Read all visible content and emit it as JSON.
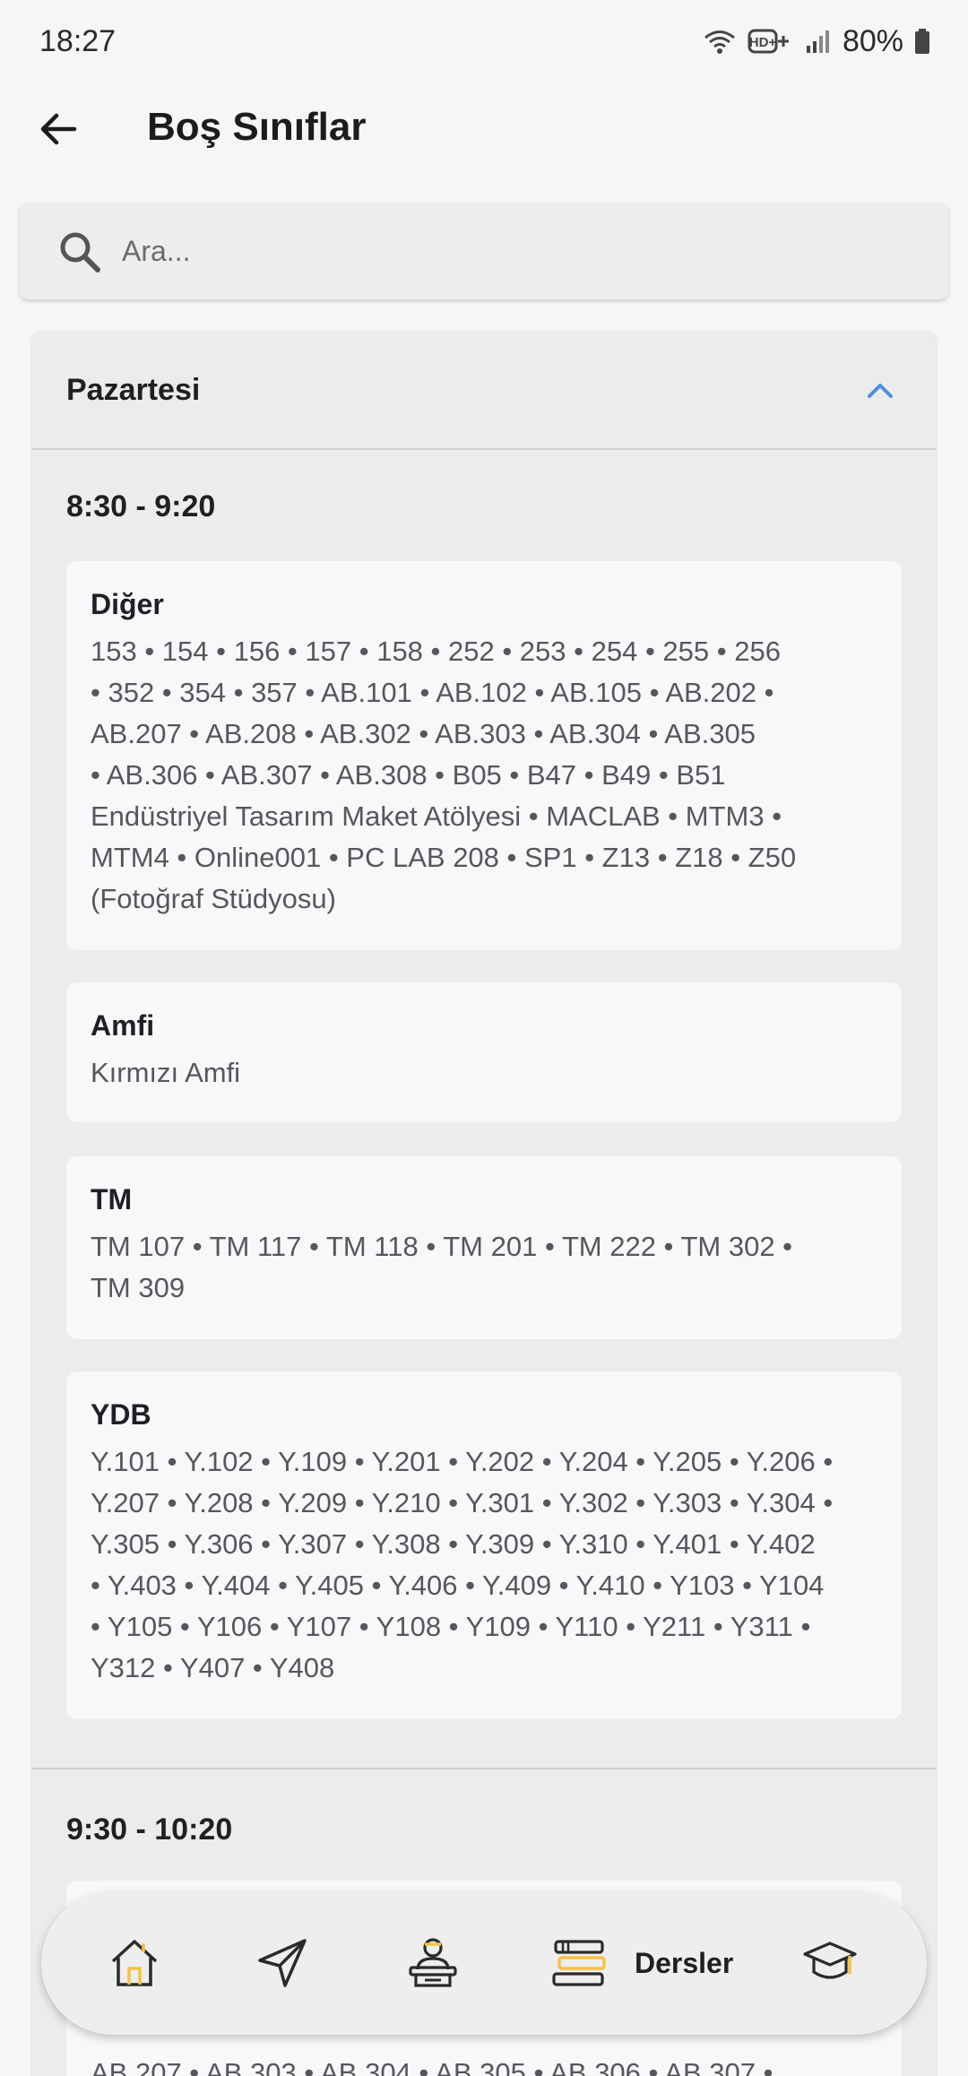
{
  "status_bar": {
    "time": "18:27",
    "network_label": "HD+",
    "battery": "80%",
    "icons": [
      "wifi-icon",
      "hd-plus-icon",
      "signal-icon",
      "battery-icon"
    ]
  },
  "app_bar": {
    "title": "Boş Sınıflar",
    "back_icon": "arrow-left-icon"
  },
  "search": {
    "placeholder": "Ara...",
    "value": ""
  },
  "day": {
    "name": "Pazartesi",
    "expanded": true,
    "accent_color": "#4a90e2"
  },
  "slots": [
    {
      "time": "8:30 - 9:20",
      "groups": [
        {
          "title": "Diğer",
          "rooms": "153 • 154 • 156 • 157 • 158 • 252 • 253 • 254 • 255 • 256\n• 352 • 354 • 357 • AB.101 • AB.102 • AB.105 • AB.202 •\nAB.207 • AB.208 • AB.302 • AB.303 • AB.304 • AB.305\n• AB.306 • AB.307 • AB.308 • B05 • B47 • B49 • B51\nEndüstriyel Tasarım Maket Atölyesi  • MACLAB • MTM3 •\nMTM4 • Online001 • PC LAB 208 • SP1 • Z13 • Z18 • Z50\n(Fotoğraf Stüdyosu)"
        },
        {
          "title": "Amfi",
          "rooms": "Kırmızı Amfi"
        },
        {
          "title": "TM",
          "rooms": "TM 107 • TM 117 • TM 118 • TM 201 • TM 222 • TM 302 •\nTM 309"
        },
        {
          "title": "YDB",
          "rooms": "Y.101 • Y.102 • Y.109 • Y.201 • Y.202 • Y.204 • Y.205 • Y.206 •\nY.207 • Y.208 • Y.209 • Y.210 • Y.301 • Y.302 • Y.303 • Y.304 •\nY.305 • Y.306 • Y.307 • Y.308 • Y.309 • Y.310 • Y.401 • Y.402\n• Y.403 • Y.404 • Y.405 • Y.406 • Y.409 • Y.410 • Y103 • Y104\n• Y105 • Y106 • Y107 • Y108 • Y109 • Y110 • Y211 • Y311 •\nY312 • Y407 • Y408"
        }
      ]
    },
    {
      "time": "9:30 - 10:20",
      "groups": [
        {
          "title": "",
          "rooms": "AB.207 • AB.303 • AB.304 • AB.305 • AB.306 • AB.307 •"
        }
      ]
    }
  ],
  "bottom_nav": {
    "active_color": "#f5c242",
    "items": [
      {
        "icon": "home-icon",
        "label": ""
      },
      {
        "icon": "send-icon",
        "label": ""
      },
      {
        "icon": "teacher-icon",
        "label": ""
      },
      {
        "icon": "books-icon",
        "label": "Dersler"
      },
      {
        "icon": "graduation-cap-icon",
        "label": ""
      }
    ]
  }
}
